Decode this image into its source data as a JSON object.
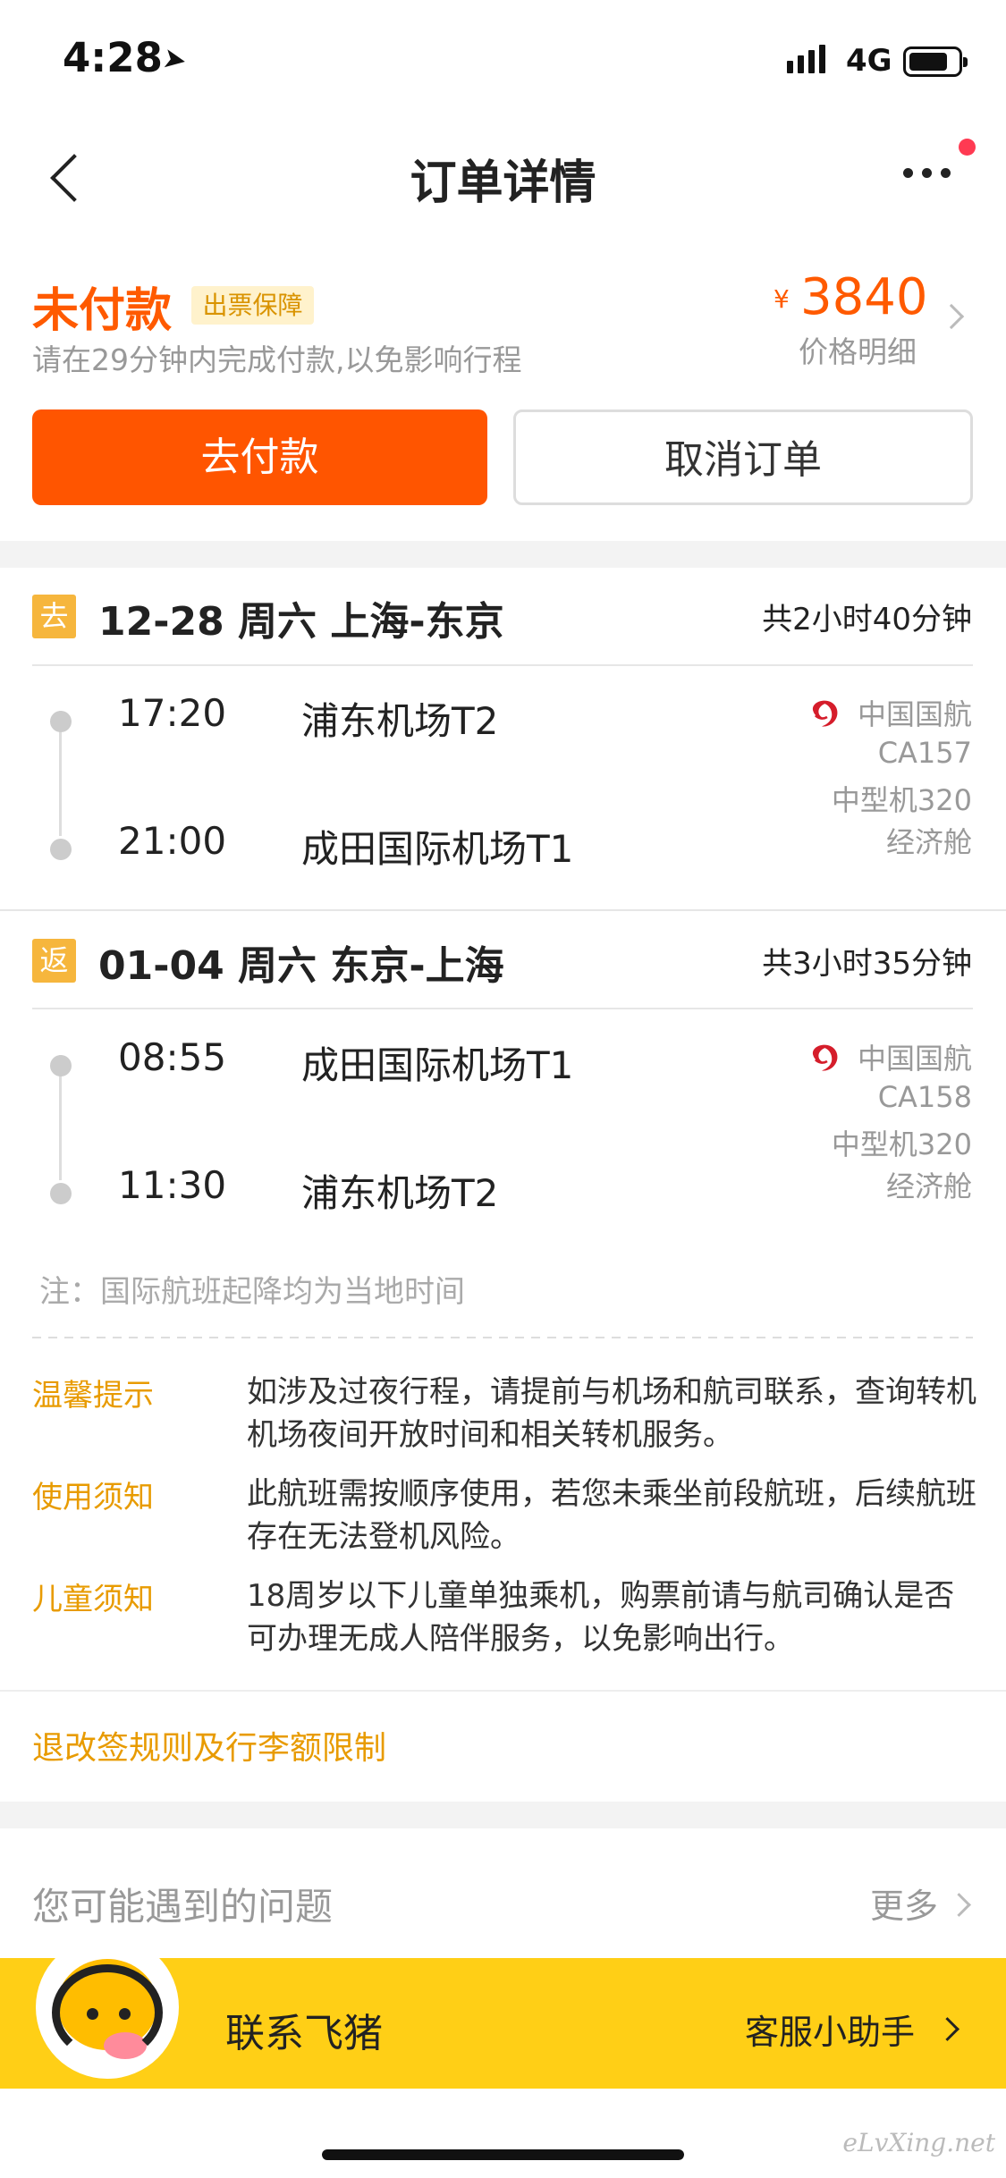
{
  "status_bar": {
    "time": "4:28",
    "network": "4G"
  },
  "header": {
    "title": "订单详情"
  },
  "order": {
    "status": "未付款",
    "guarantee": "出票保障",
    "hint": "请在29分钟内完成付款,以免影响行程",
    "currency": "¥",
    "price": "3840",
    "price_detail": "价格明细",
    "pay_button": "去付款",
    "cancel_button": "取消订单"
  },
  "routes": [
    {
      "tag": "去",
      "date_route": "12-28 周六 上海-东京",
      "duration": "共2小时40分钟",
      "depart_time": "17:20",
      "depart_airport": "浦东机场T2",
      "arrive_time": "21:00",
      "arrive_airport": "成田国际机场T1",
      "airline": "中国国航",
      "flight_no": "CA157",
      "aircraft": "中型机320",
      "cabin": "经济舱"
    },
    {
      "tag": "返",
      "date_route": "01-04 周六 东京-上海",
      "duration": "共3小时35分钟",
      "depart_time": "08:55",
      "depart_airport": "成田国际机场T1",
      "arrive_time": "11:30",
      "arrive_airport": "浦东机场T2",
      "airline": "中国国航",
      "flight_no": "CA158",
      "aircraft": "中型机320",
      "cabin": "经济舱"
    }
  ],
  "note": "注：国际航班起降均为当地时间",
  "tips": [
    {
      "label": "温馨提示",
      "text": "如涉及过夜行程，请提前与机场和航司联系，查询转机机场夜间开放时间和相关转机服务。"
    },
    {
      "label": "使用须知",
      "text": "此航班需按顺序使用，若您未乘坐前段航班，后续航班存在无法登机风险。"
    },
    {
      "label": "儿童须知",
      "text": "18周岁以下儿童单独乘机，购票前请与航司确认是否可办理无成人陪伴服务，以免影响出行。"
    }
  ],
  "rules_link": "退改签规则及行李额限制",
  "problems": {
    "title": "您可能遇到的问题",
    "more": "更多"
  },
  "contact": {
    "label": "联系飞猪",
    "helper": "客服小助手"
  },
  "watermark": "eLvXing.net",
  "colors": {
    "accent": "#ff5500",
    "warning": "#e89b00",
    "contact_bar": "#ffcf16"
  }
}
